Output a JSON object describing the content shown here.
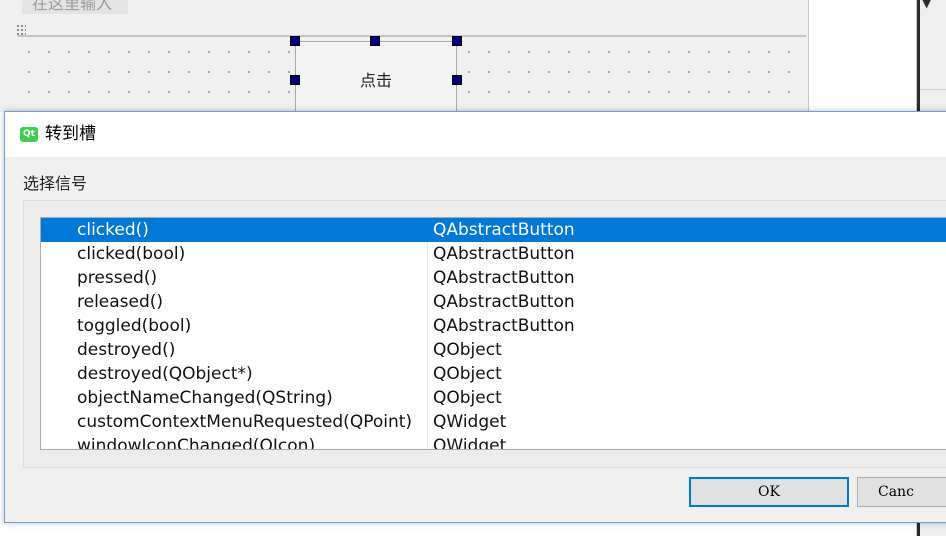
{
  "background": {
    "line_edit_placeholder": "在这里输入",
    "push_button_text": "点击"
  },
  "dialog": {
    "title": "转到槽",
    "icon": "qt-logo-icon",
    "icon_text": "Qt",
    "section_label": "选择信号",
    "signals": [
      {
        "signal": "clicked()",
        "class": "QAbstractButton",
        "selected": true
      },
      {
        "signal": "clicked(bool)",
        "class": "QAbstractButton"
      },
      {
        "signal": "pressed()",
        "class": "QAbstractButton"
      },
      {
        "signal": "released()",
        "class": "QAbstractButton"
      },
      {
        "signal": "toggled(bool)",
        "class": "QAbstractButton"
      },
      {
        "signal": "destroyed()",
        "class": "QObject"
      },
      {
        "signal": "destroyed(QObject*)",
        "class": "QObject"
      },
      {
        "signal": "objectNameChanged(QString)",
        "class": "QObject"
      },
      {
        "signal": "customContextMenuRequested(QPoint)",
        "class": "QWidget"
      },
      {
        "signal": "windowIconChanged(QIcon)",
        "class": "QWidget"
      }
    ],
    "ok_label": "OK",
    "cancel_label": "Canc"
  },
  "colors": {
    "selection": "#0078d7",
    "qt_green": "#41cd52",
    "handle": "#000080"
  }
}
